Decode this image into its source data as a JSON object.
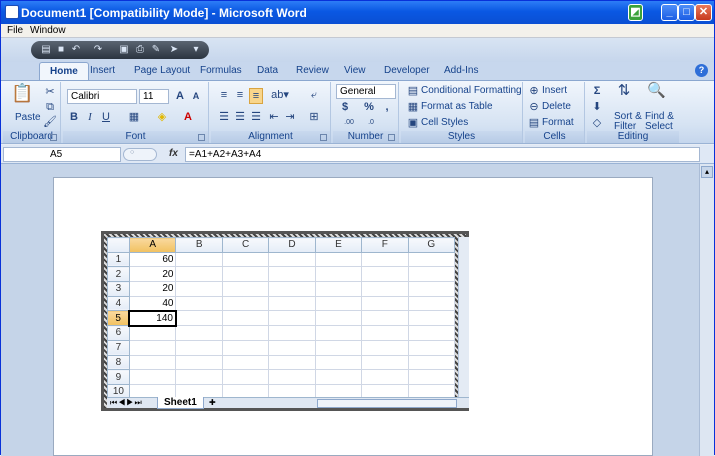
{
  "window": {
    "title": "Document1 [Compatibility Mode] - Microsoft Word"
  },
  "menu": [
    "File",
    "Window"
  ],
  "tabs": [
    "Home",
    "Insert",
    "Page Layout",
    "Formulas",
    "Data",
    "Review",
    "View",
    "Developer",
    "Add-Ins"
  ],
  "ribbon": {
    "clipboard": {
      "label": "Clipboard",
      "paste": "Paste"
    },
    "font": {
      "label": "Font",
      "name": "Calibri",
      "size": "11"
    },
    "alignment": {
      "label": "Alignment"
    },
    "number": {
      "label": "Number",
      "format": "General"
    },
    "styles": {
      "label": "Styles",
      "conditional": "Conditional Formatting",
      "format_table": "Format as Table",
      "cell_styles": "Cell Styles"
    },
    "cells": {
      "label": "Cells",
      "insert": "Insert",
      "delete": "Delete",
      "format": "Format"
    },
    "editing": {
      "label": "Editing",
      "sort1": "Sort &",
      "sort2": "Filter",
      "find1": "Find &",
      "find2": "Select"
    }
  },
  "formula_bar": {
    "cell": "A5",
    "formula": "=A1+A2+A3+A4",
    "fx": "fx"
  },
  "sheet": {
    "columns": [
      "A",
      "B",
      "C",
      "D",
      "E",
      "F",
      "G"
    ],
    "rows": [
      "1",
      "2",
      "3",
      "4",
      "5",
      "6",
      "7",
      "8",
      "9",
      "10"
    ],
    "values": [
      "60",
      "20",
      "20",
      "40",
      "140",
      "",
      "",
      "",
      "",
      ""
    ],
    "tab": "Sheet1"
  },
  "colors": {
    "accent": "#15428b",
    "selected_header": "#f1c15f"
  }
}
